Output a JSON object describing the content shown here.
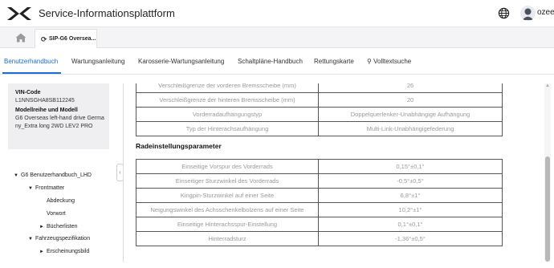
{
  "header": {
    "app_title": "Service-Informationsplattform",
    "user": "ozeec"
  },
  "tabs": {
    "doc_tab_label": "SIP-G6 Oversea..."
  },
  "nav": [
    "Benutzerhandbuch",
    "Wartungsanleitung",
    "Karosserie-Wartungsanleitung",
    "Schaltpläne-Handbuch",
    "Rettungskarte",
    "Volltextsuche"
  ],
  "sidebar": {
    "vin_label": "VIN-Code",
    "vin_value": "L1NNSGHA8SB112245",
    "model_label": "Modellreihe und Modell",
    "model_value_1": "G6 Overseas left-hand drive Germa",
    "model_value_2": "ny_Extra long 2WD LEV2 PRO",
    "tree": [
      {
        "label": "G6 Benutzerhandbuch_LHD",
        "arrow": "▼"
      },
      {
        "label": "Frontmatter",
        "arrow": "▼"
      },
      {
        "label": "Abdeckung",
        "arrow": ""
      },
      {
        "label": "Vorwort",
        "arrow": ""
      },
      {
        "label": "Bücherlisten",
        "arrow": "►"
      },
      {
        "label": "Fahrzeugspezifikation",
        "arrow": "▼"
      },
      {
        "label": "Erscheinungsbild",
        "arrow": "►"
      }
    ]
  },
  "content": {
    "table1": [
      [
        "Verschleißgrenze der vorderen Bremsscheibe (mm)",
        "26"
      ],
      [
        "Verschleißgrenze der hinteren Bremsscheibe (mm)",
        "20"
      ],
      [
        "Vorderradaufhängungstyp",
        "Doppelquerlenker-Unabhängige Aufhängung"
      ],
      [
        "Typ der Hinterachsaufhängung",
        "Multi-Link-Unabhängigefederung"
      ]
    ],
    "section_title": "Radeinstellungsparameter",
    "table2": [
      [
        "Einseitige Vorspur des Vorderrads",
        "0,15°±0,1°"
      ],
      [
        "Einseitiger Sturzwinkel des Vorderrads",
        "-0,5°±0,5°"
      ],
      [
        "Kingpin-Sturzwinkel auf einer Seite",
        "6,8°±1°"
      ],
      [
        "Neigungswinkel des Achsschenkelbolzens auf einer Seite",
        "10,2°±1°"
      ],
      [
        "Einseitige Hinterachsspur-Einstellung",
        "0,1°±0,1°"
      ],
      [
        "Hinterradsturz",
        "-1,36°±0,5°"
      ]
    ]
  }
}
